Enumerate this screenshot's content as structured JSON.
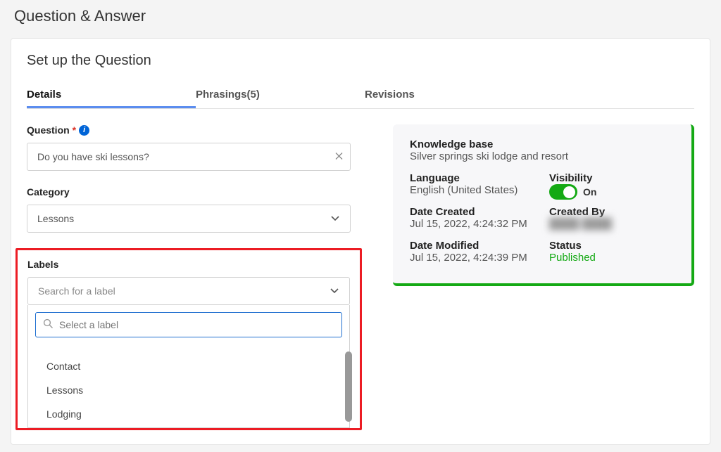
{
  "page_title": "Question & Answer",
  "card_title": "Set up the Question",
  "tabs": {
    "details": "Details",
    "phrasings": "Phrasings(5)",
    "revisions": "Revisions"
  },
  "form": {
    "question_label": "Question",
    "question_value": "Do you have ski lessons?",
    "category_label": "Category",
    "category_value": "Lessons",
    "labels_label": "Labels",
    "labels_placeholder": "Search for a label",
    "labels_search_placeholder": "Select a label",
    "label_options": {
      "opt0": "Contact",
      "opt1": "Lessons",
      "opt2": "Lodging"
    }
  },
  "meta": {
    "kb_label": "Knowledge base",
    "kb_value": "Silver springs ski lodge and resort",
    "lang_label": "Language",
    "lang_value": "English (United States)",
    "vis_label": "Visibility",
    "vis_on": "On",
    "created_label": "Date Created",
    "created_value": "Jul 15, 2022, 4:24:32 PM",
    "createdby_label": "Created By",
    "createdby_value": "████ ████",
    "modified_label": "Date Modified",
    "modified_value": "Jul 15, 2022, 4:24:39 PM",
    "status_label": "Status",
    "status_value": "Published"
  },
  "colors": {
    "accent_green": "#14a914",
    "highlight_red": "#ec1c24",
    "link_blue": "#5b8def"
  }
}
